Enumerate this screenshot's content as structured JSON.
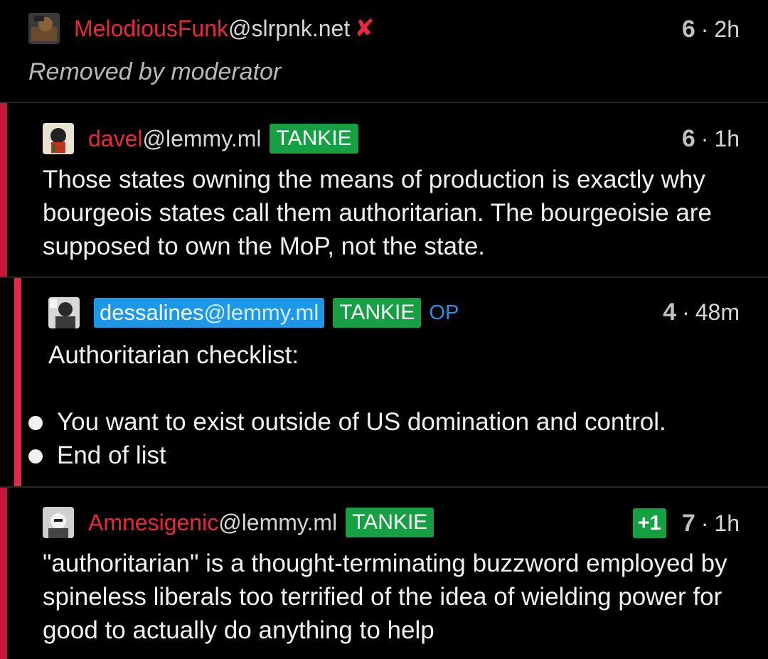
{
  "comments": [
    {
      "user": "MelodiousFunk",
      "instance": "@slrpnk.net",
      "score": "6",
      "age": "2h",
      "body": "Removed by moderator",
      "removed_icon": "x-icon"
    },
    {
      "user": "davel",
      "instance": "@lemmy.ml",
      "tag": "TANKIE",
      "score": "6",
      "age": "1h",
      "body": "Those states owning the means of production is exactly why bourgeois states call them authoritarian. The bourgeoisie are supposed to own the MoP, not the state."
    },
    {
      "user": "dessalines",
      "instance": "@lemmy.ml",
      "tag": "TANKIE",
      "op": "OP",
      "score": "4",
      "age": "48m",
      "body_intro": "Authoritarian checklist:",
      "list": [
        "You want to exist outside of US domination and control.",
        "End of list"
      ]
    },
    {
      "user": "Amnesigenic",
      "instance": "@lemmy.ml",
      "tag": "TANKIE",
      "vote": "+1",
      "score": "7",
      "age": "1h",
      "body": "\"authoritarian\" is a thought-terminating buzzword employed by spineless liberals too terrified of the idea of wielding power for good to actually do anything to help"
    }
  ],
  "colors": {
    "background": "#000000",
    "username": "#e8283d",
    "depth_bar": "#c4173a",
    "depth_bar_2": "#e02848",
    "tag": "#17a043",
    "op_highlight": "#1d97e8"
  },
  "separator": "·"
}
